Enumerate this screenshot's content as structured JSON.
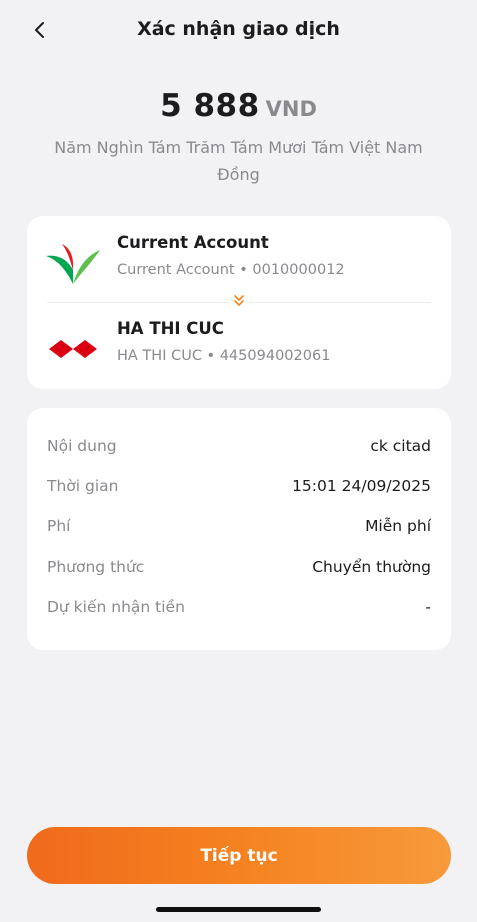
{
  "header": {
    "title": "Xác nhận giao dịch",
    "back_icon": "chevron-left-icon"
  },
  "amount": {
    "value": "5 888",
    "currency": "VND",
    "in_words": "Năm Nghìn Tám Trăm Tám Mươi Tám Việt Nam Đồng"
  },
  "source_account": {
    "name": "Current Account",
    "detail": "Current Account • 0010000012",
    "logo_icon": "vpbank-logo-icon"
  },
  "destination_account": {
    "name": "HA THI CUC",
    "detail": "HA THI CUC • 445094002061",
    "logo_icon": "hsbc-logo-icon"
  },
  "transfer_direction_icon": "double-chevron-down-icon",
  "details": [
    {
      "label": "Nội dung",
      "value": "ck citad"
    },
    {
      "label": "Thời gian",
      "value": "15:01 24/09/2025"
    },
    {
      "label": "Phí",
      "value": "Miễn phí"
    },
    {
      "label": "Phương thức",
      "value": "Chuyển thường"
    },
    {
      "label": "Dự kiến nhận tiền",
      "value": "-"
    }
  ],
  "continue_button": {
    "label": "Tiếp tục"
  },
  "colors": {
    "accent": "#f58220",
    "background": "#f2f2f5",
    "card": "#ffffff",
    "muted_text": "#8a8a8e",
    "hsbc_red": "#db0011",
    "vp_green": "#00a651",
    "vp_red": "#e31d24"
  }
}
